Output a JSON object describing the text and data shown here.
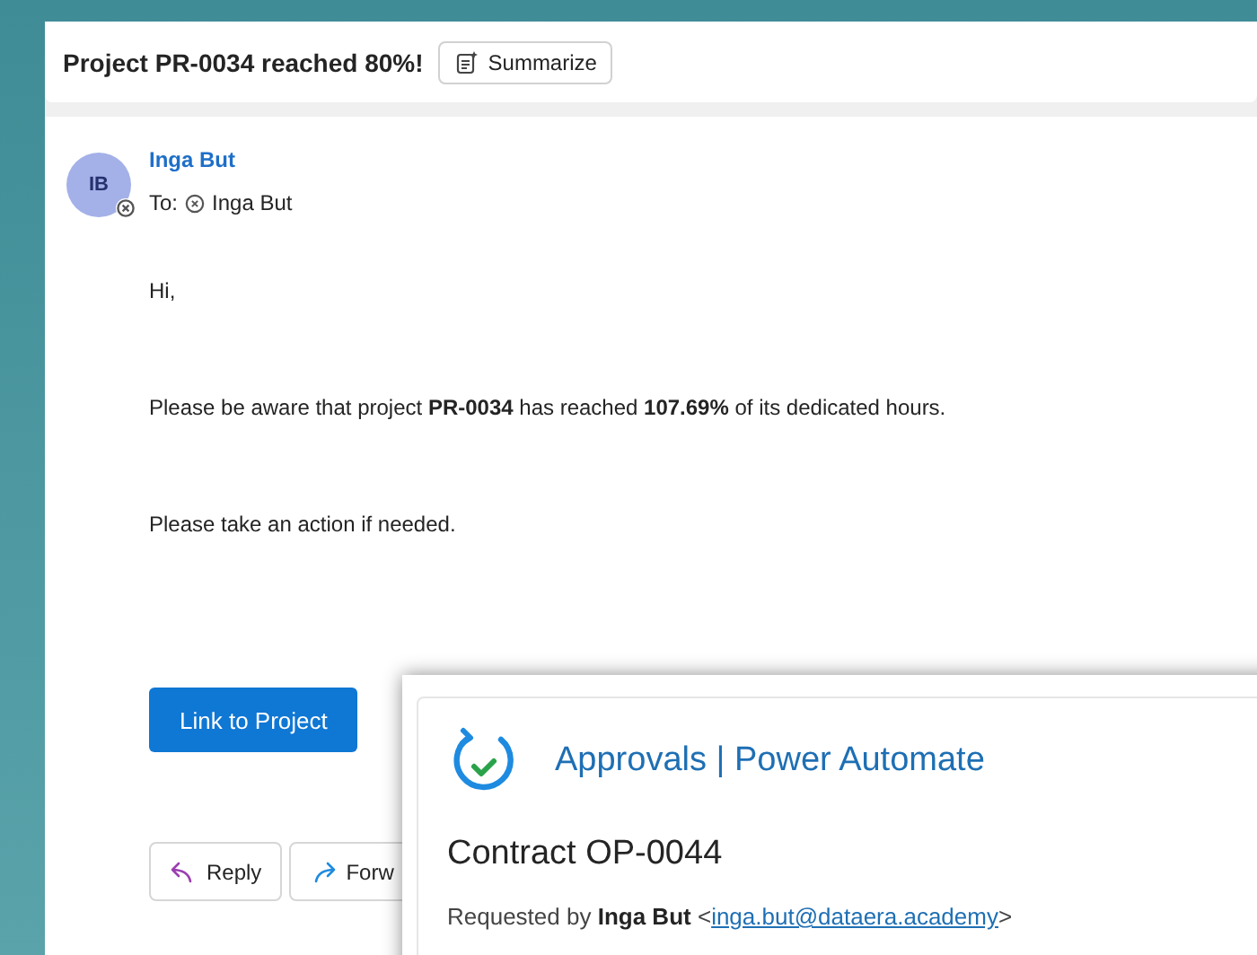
{
  "subject": "Project PR-0034 reached 80%!",
  "summarize_button": "Summarize",
  "sender": {
    "initials": "IB",
    "name": "Inga But"
  },
  "to": {
    "label": "To:",
    "recipient": "Inga But"
  },
  "body": [
    "Hi,",
    "Please be aware that project **PR-0034** has reached **107.69%** of its dedicated hours.",
    "Please take an action if needed."
  ],
  "link_button": "Link to Project",
  "actions": [
    {
      "kind": "reply",
      "label": "Reply"
    },
    {
      "kind": "forward",
      "label": "Forw"
    }
  ],
  "approval": {
    "brand": "Approvals | Power Automate",
    "title": "Contract OP-0044",
    "requested_label": "Requested by",
    "requester": "Inga But",
    "bracket_open": "<",
    "email": "inga.but@dataera.academy",
    "bracket_close": ">"
  }
}
